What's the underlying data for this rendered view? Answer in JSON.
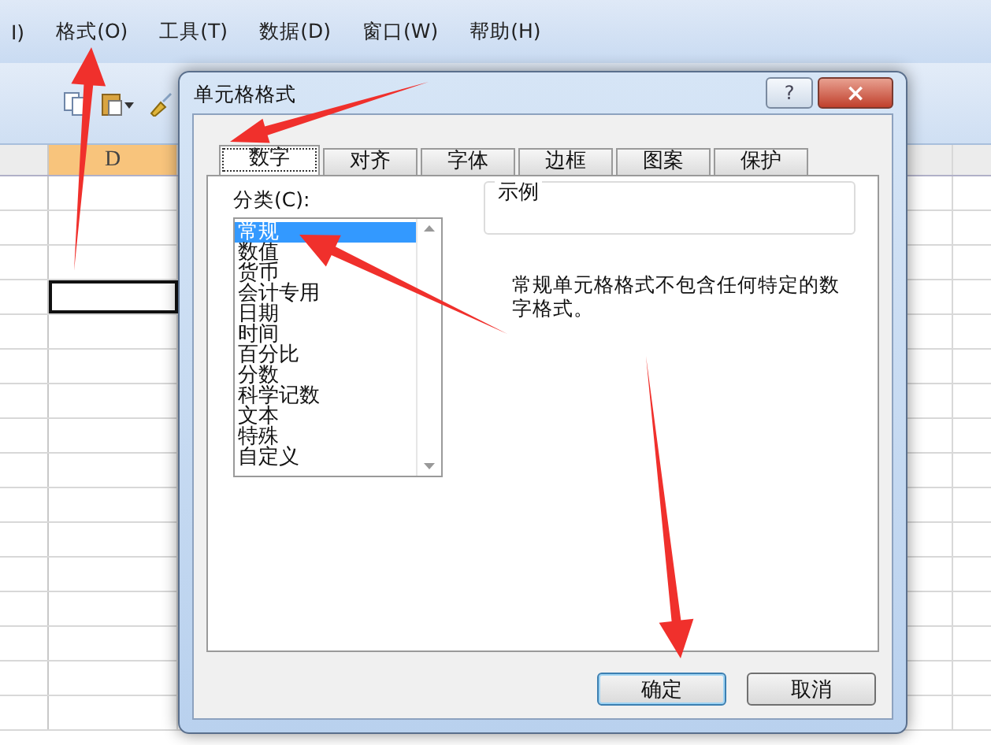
{
  "menu": [
    {
      "label": "I)"
    },
    {
      "label": "格式(O)"
    },
    {
      "label": "工具(T)"
    },
    {
      "label": "数据(D)"
    },
    {
      "label": "窗口(W)"
    },
    {
      "label": "帮助(H)"
    }
  ],
  "sheet": {
    "column": "D",
    "rows": [
      {
        "selected": false
      },
      {
        "selected": false
      },
      {
        "selected": false
      },
      {
        "selected": true
      },
      {
        "selected": false
      },
      {
        "selected": false
      },
      {
        "selected": false
      },
      {
        "selected": false
      },
      {
        "selected": false
      },
      {
        "selected": false
      },
      {
        "selected": false
      },
      {
        "selected": false
      },
      {
        "selected": false
      },
      {
        "selected": false
      },
      {
        "selected": false
      },
      {
        "selected": false
      }
    ]
  },
  "dialog": {
    "title": "单元格格式",
    "help": "?",
    "close": "×",
    "tabs": [
      {
        "label": "数字",
        "selected": true
      },
      {
        "label": "对齐",
        "selected": false
      },
      {
        "label": "字体",
        "selected": false
      },
      {
        "label": "边框",
        "selected": false
      },
      {
        "label": "图案",
        "selected": false
      },
      {
        "label": "保护",
        "selected": false
      }
    ],
    "category_label": "分类(C):",
    "categories": [
      {
        "label": "常规",
        "selected": true
      },
      {
        "label": "数值",
        "selected": false
      },
      {
        "label": "货币",
        "selected": false
      },
      {
        "label": "会计专用",
        "selected": false
      },
      {
        "label": "日期",
        "selected": false
      },
      {
        "label": "时间",
        "selected": false
      },
      {
        "label": "百分比",
        "selected": false
      },
      {
        "label": "分数",
        "selected": false
      },
      {
        "label": "科学记数",
        "selected": false
      },
      {
        "label": "文本",
        "selected": false
      },
      {
        "label": "特殊",
        "selected": false
      },
      {
        "label": "自定义",
        "selected": false
      }
    ],
    "sample_label": "示例",
    "description": "常规单元格格式不包含任何特定的数字格式。",
    "buttons": [
      {
        "label": "确定",
        "default": true
      },
      {
        "label": "取消",
        "default": false
      }
    ]
  }
}
